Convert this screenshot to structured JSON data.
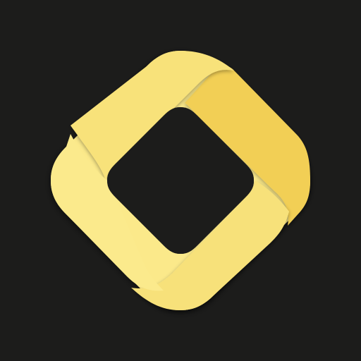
{
  "icon": {
    "name": "rounded-diamond-ring-logo",
    "colors": {
      "background": "#1c1c1b",
      "band_light": "#fbe98a",
      "band_mid": "#f8e27a",
      "band_fold": "#f3dc72",
      "band_dark": "#f2cf55",
      "shadow": "#000000"
    }
  }
}
